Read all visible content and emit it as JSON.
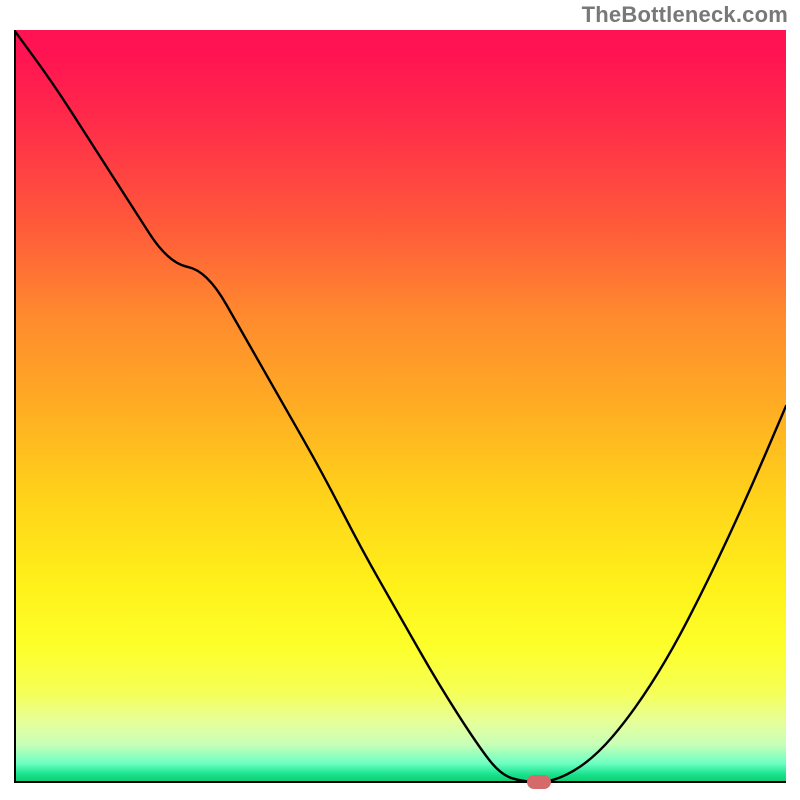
{
  "attribution": "TheBottleneck.com",
  "colors": {
    "curve": "#000000",
    "marker": "#d46a6a",
    "gradient_top": "#ff1352",
    "gradient_bottom": "#13c96f"
  },
  "chart_data": {
    "type": "line",
    "title": "",
    "xlabel": "",
    "ylabel": "",
    "xlim": [
      0,
      100
    ],
    "ylim": [
      0,
      100
    ],
    "x": [
      0,
      5,
      10,
      15,
      20,
      25,
      30,
      35,
      40,
      45,
      50,
      55,
      60,
      63,
      66,
      70,
      75,
      80,
      85,
      90,
      95,
      100
    ],
    "values": [
      100,
      93,
      85,
      77,
      69,
      68,
      59,
      50,
      41,
      31,
      22,
      13,
      5,
      1,
      0,
      0,
      3,
      9,
      17,
      27,
      38,
      50
    ],
    "marker": {
      "x": 68,
      "y": 0
    },
    "annotations": []
  }
}
